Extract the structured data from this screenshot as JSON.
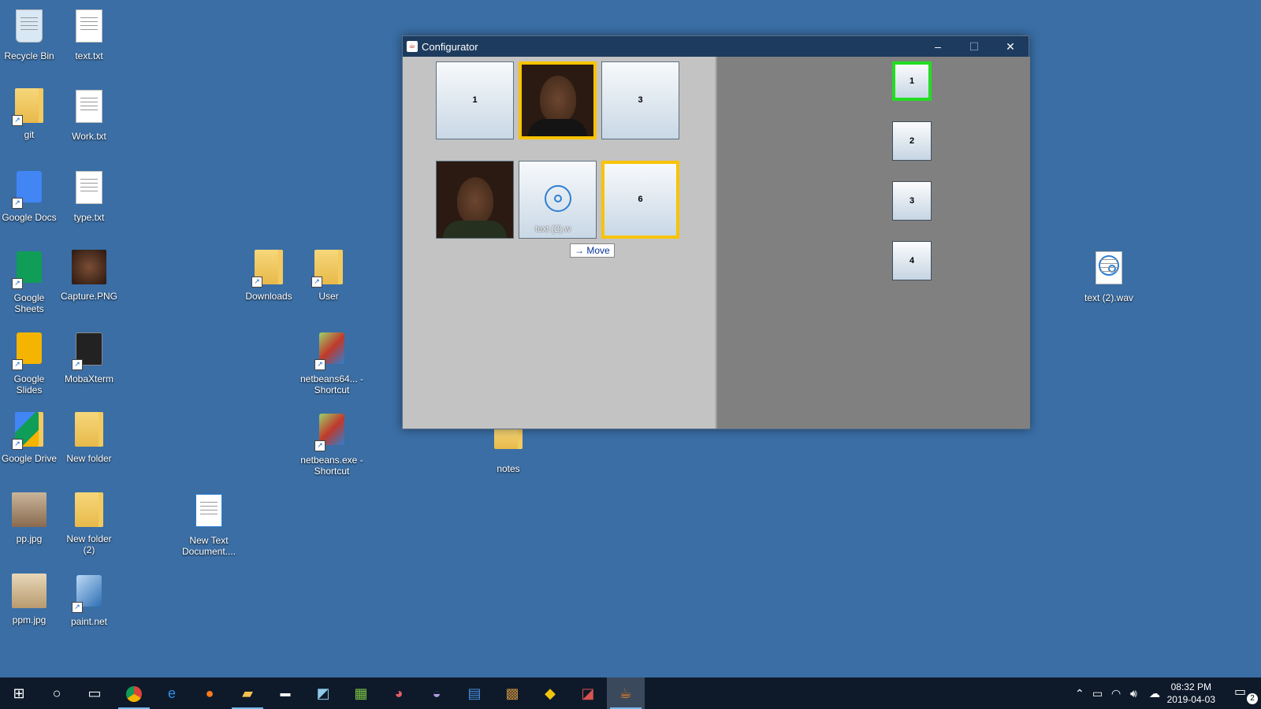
{
  "desktop": {
    "icons": [
      {
        "label": "Recycle Bin"
      },
      {
        "label": "text.txt"
      },
      {
        "label": "git"
      },
      {
        "label": "Work.txt"
      },
      {
        "label": "Google Docs"
      },
      {
        "label": "type.txt"
      },
      {
        "label": "Google Sheets"
      },
      {
        "label": "Capture.PNG"
      },
      {
        "label": "Downloads"
      },
      {
        "label": "User"
      },
      {
        "label": "Google Slides"
      },
      {
        "label": "MobaXterm"
      },
      {
        "label": "netbeans64... - Shortcut"
      },
      {
        "label": "Google Drive"
      },
      {
        "label": "New folder"
      },
      {
        "label": "netbeans.exe - Shortcut"
      },
      {
        "label": "notes"
      },
      {
        "label": "pp.jpg"
      },
      {
        "label": "New folder (2)"
      },
      {
        "label": "New Text Document...."
      },
      {
        "label": "ppm.jpg"
      },
      {
        "label": "paint.net"
      },
      {
        "label": "text (2).wav"
      }
    ]
  },
  "window": {
    "title": "Configurator",
    "controls": {
      "minimize": "–",
      "maximize": "☐",
      "close": "✕"
    },
    "left_panel": {
      "tiles": [
        {
          "label": "1",
          "kind": "text"
        },
        {
          "label": "",
          "kind": "photo",
          "selected": true
        },
        {
          "label": "3",
          "kind": "text"
        },
        {
          "label": "",
          "kind": "photo"
        },
        {
          "label": "text (2).w",
          "kind": "audio-file"
        },
        {
          "label": "6",
          "kind": "text",
          "selected": true
        }
      ],
      "drag_tooltip": "→ Move"
    },
    "right_panel": {
      "slots": [
        {
          "label": "1",
          "active": true
        },
        {
          "label": "2"
        },
        {
          "label": "3"
        },
        {
          "label": "4"
        }
      ]
    }
  },
  "taskbar": {
    "start_icon": "windows-start-icon",
    "apps": [
      "search",
      "task-view",
      "chrome",
      "edge",
      "firefox",
      "file-explorer",
      "cmd",
      "notepad",
      "sheets-app",
      "paint-app",
      "eclipse",
      "docs-app",
      "game-app",
      "git-app",
      "paint-net",
      "java-app"
    ],
    "clock_time": "08:32 PM",
    "clock_date": "2019-04-03",
    "notification_count": "2"
  }
}
